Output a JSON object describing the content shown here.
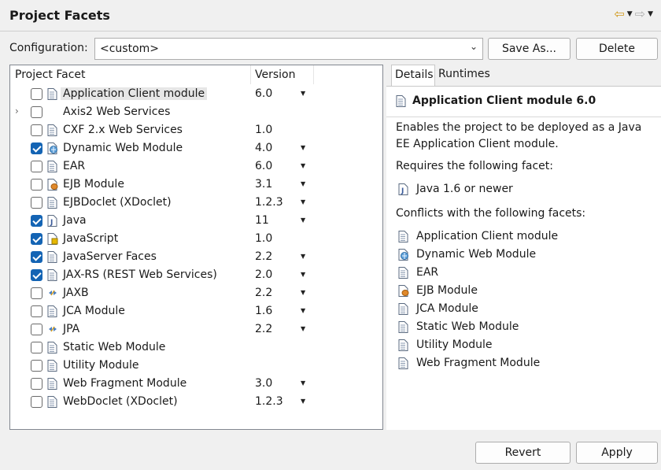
{
  "window": {
    "title": "Project Facets"
  },
  "nav": {
    "back_icon": "back-arrow-icon",
    "forward_icon": "forward-arrow-icon"
  },
  "config": {
    "label": "Configuration:",
    "value": "<custom>",
    "save_as_label": "Save As...",
    "delete_label": "Delete"
  },
  "table": {
    "col_facet": "Project Facet",
    "col_version": "Version",
    "rows": [
      {
        "name": "Application Client module",
        "version": "6.0",
        "checked": false,
        "dropdown": true,
        "icon": "doc",
        "selected": true,
        "expander": false
      },
      {
        "name": "Axis2 Web Services",
        "version": "",
        "checked": false,
        "dropdown": false,
        "icon": "none",
        "selected": false,
        "expander": true
      },
      {
        "name": "CXF 2.x Web Services",
        "version": "1.0",
        "checked": false,
        "dropdown": false,
        "icon": "doc",
        "selected": false,
        "expander": false
      },
      {
        "name": "Dynamic Web Module",
        "version": "4.0",
        "checked": true,
        "dropdown": true,
        "icon": "web",
        "selected": false,
        "expander": false
      },
      {
        "name": "EAR",
        "version": "6.0",
        "checked": false,
        "dropdown": true,
        "icon": "doc",
        "selected": false,
        "expander": false
      },
      {
        "name": "EJB Module",
        "version": "3.1",
        "checked": false,
        "dropdown": true,
        "icon": "ejb",
        "selected": false,
        "expander": false
      },
      {
        "name": "EJBDoclet (XDoclet)",
        "version": "1.2.3",
        "checked": false,
        "dropdown": true,
        "icon": "doc",
        "selected": false,
        "expander": false
      },
      {
        "name": "Java",
        "version": "11",
        "checked": true,
        "dropdown": true,
        "icon": "java",
        "selected": false,
        "expander": false
      },
      {
        "name": "JavaScript",
        "version": "1.0",
        "checked": true,
        "dropdown": false,
        "icon": "js",
        "selected": false,
        "expander": false
      },
      {
        "name": "JavaServer Faces",
        "version": "2.2",
        "checked": true,
        "dropdown": true,
        "icon": "doc",
        "selected": false,
        "expander": false
      },
      {
        "name": "JAX-RS (REST Web Services)",
        "version": "2.0",
        "checked": true,
        "dropdown": true,
        "icon": "doc",
        "selected": false,
        "expander": false
      },
      {
        "name": "JAXB",
        "version": "2.2",
        "checked": false,
        "dropdown": true,
        "icon": "xml",
        "selected": false,
        "expander": false
      },
      {
        "name": "JCA Module",
        "version": "1.6",
        "checked": false,
        "dropdown": true,
        "icon": "doc",
        "selected": false,
        "expander": false
      },
      {
        "name": "JPA",
        "version": "2.2",
        "checked": false,
        "dropdown": true,
        "icon": "xml",
        "selected": false,
        "expander": false
      },
      {
        "name": "Static Web Module",
        "version": "",
        "checked": false,
        "dropdown": false,
        "icon": "doc",
        "selected": false,
        "expander": false
      },
      {
        "name": "Utility Module",
        "version": "",
        "checked": false,
        "dropdown": false,
        "icon": "doc",
        "selected": false,
        "expander": false
      },
      {
        "name": "Web Fragment Module",
        "version": "3.0",
        "checked": false,
        "dropdown": true,
        "icon": "doc",
        "selected": false,
        "expander": false
      },
      {
        "name": "WebDoclet (XDoclet)",
        "version": "1.2.3",
        "checked": false,
        "dropdown": true,
        "icon": "doc",
        "selected": false,
        "expander": false
      }
    ]
  },
  "tabs": {
    "details": "Details",
    "runtimes": "Runtimes"
  },
  "details": {
    "title": "Application Client module 6.0",
    "description": "Enables the project to be deployed as a Java EE Application Client module.",
    "requires_label": "Requires the following facet:",
    "requires": [
      {
        "text": "Java 1.6 or newer",
        "icon": "java"
      }
    ],
    "conflicts_label": "Conflicts with the following facets:",
    "conflicts": [
      {
        "text": "Application Client module",
        "icon": "doc"
      },
      {
        "text": "Dynamic Web Module",
        "icon": "web"
      },
      {
        "text": "EAR",
        "icon": "doc"
      },
      {
        "text": "EJB Module",
        "icon": "ejb"
      },
      {
        "text": "JCA Module",
        "icon": "doc"
      },
      {
        "text": "Static Web Module",
        "icon": "doc"
      },
      {
        "text": "Utility Module",
        "icon": "doc"
      },
      {
        "text": "Web Fragment Module",
        "icon": "doc"
      }
    ]
  },
  "footer": {
    "revert_label": "Revert",
    "apply_label": "Apply"
  },
  "colors": {
    "checkbox_checked": "#1464b4",
    "selection": "#e6e6e6",
    "back_arrow": "#d19a1d"
  }
}
